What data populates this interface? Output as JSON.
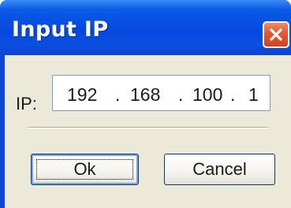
{
  "dialog": {
    "title": "Input IP",
    "close_icon": "close-x",
    "ip_label": "IP:",
    "ip_segments": [
      "192",
      "168",
      "100",
      "1"
    ],
    "ip_separator": ".",
    "ok_label": "Ok",
    "cancel_label": "Cancel"
  },
  "colors": {
    "titlebar": "#0a5ae8",
    "close_button": "#e2582f",
    "client_bg": "#ece9d8"
  }
}
